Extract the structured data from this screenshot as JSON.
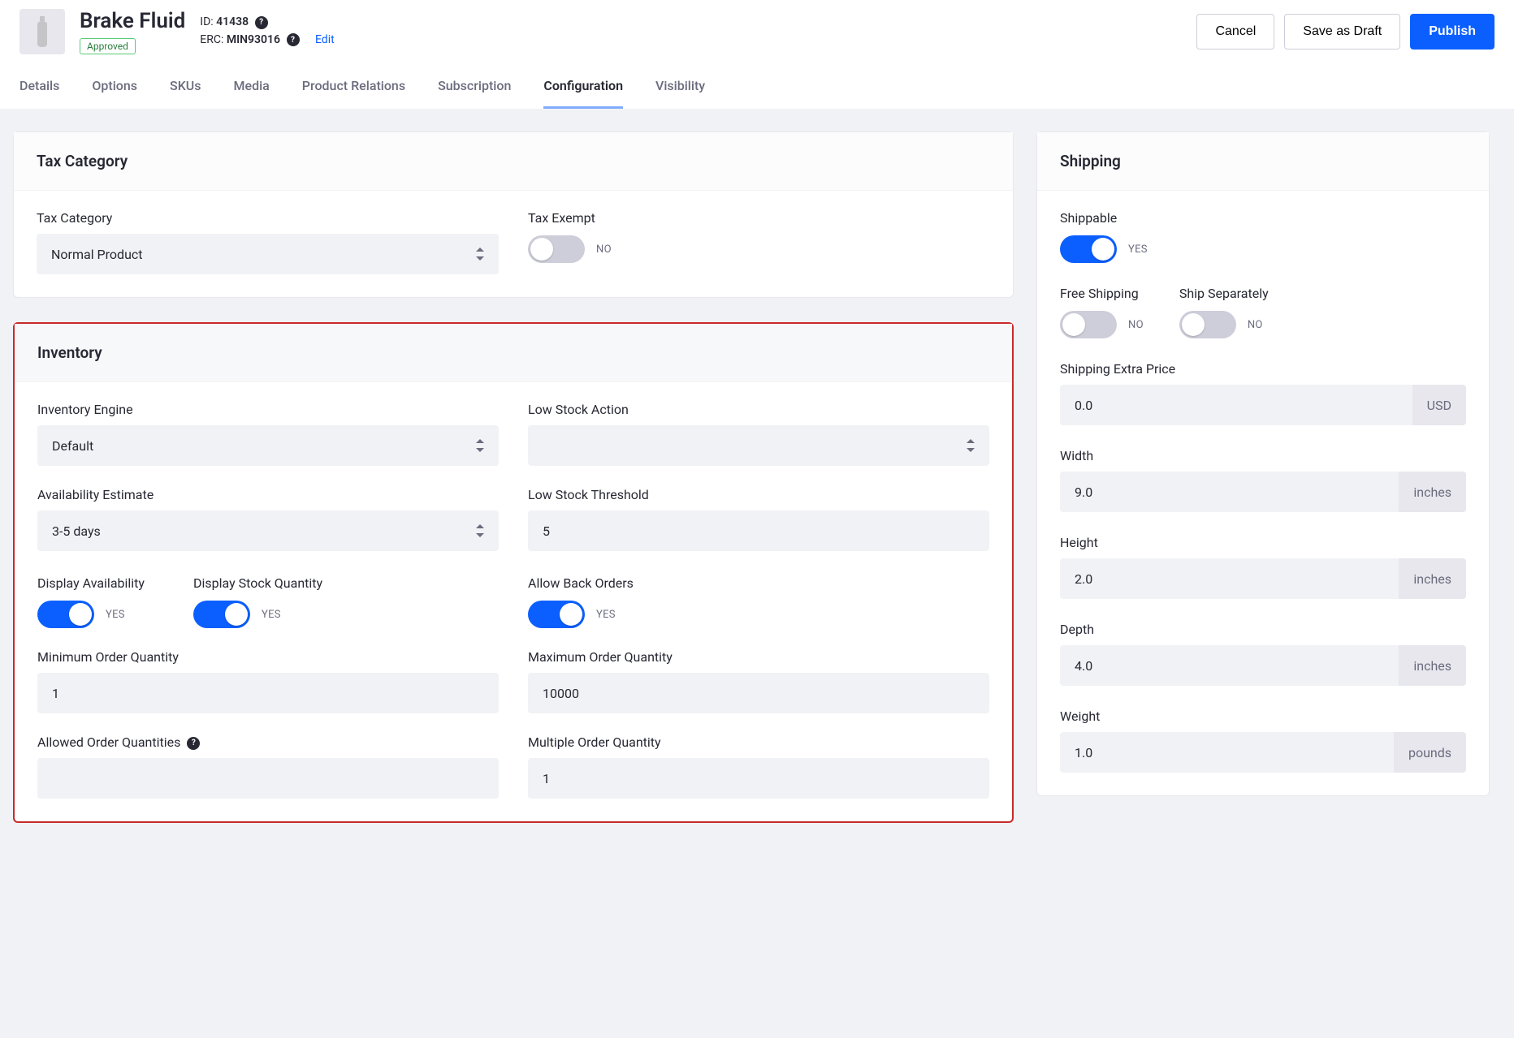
{
  "header": {
    "title": "Brake Fluid",
    "status_badge": "Approved",
    "id_label": "ID:",
    "id_value": "41438",
    "erc_label": "ERC:",
    "erc_value": "MIN93016",
    "edit": "Edit",
    "actions": {
      "cancel": "Cancel",
      "draft": "Save as Draft",
      "publish": "Publish"
    }
  },
  "tabs": [
    "Details",
    "Options",
    "SKUs",
    "Media",
    "Product Relations",
    "Subscription",
    "Configuration",
    "Visibility"
  ],
  "active_tab": "Configuration",
  "tax": {
    "panel_title": "Tax Category",
    "category_label": "Tax Category",
    "category_value": "Normal Product",
    "exempt_label": "Tax Exempt",
    "exempt_on": false,
    "exempt_text": "NO"
  },
  "inventory": {
    "panel_title": "Inventory",
    "engine_label": "Inventory Engine",
    "engine_value": "Default",
    "low_action_label": "Low Stock Action",
    "low_action_value": "",
    "avail_label": "Availability Estimate",
    "avail_value": "3-5 days",
    "threshold_label": "Low Stock Threshold",
    "threshold_value": "5",
    "disp_avail_label": "Display Availability",
    "disp_avail_text": "YES",
    "disp_stock_label": "Display Stock Quantity",
    "disp_stock_text": "YES",
    "back_label": "Allow Back Orders",
    "back_text": "YES",
    "min_label": "Minimum Order Quantity",
    "min_value": "1",
    "max_label": "Maximum Order Quantity",
    "max_value": "10000",
    "allowed_label": "Allowed Order Quantities",
    "allowed_value": "",
    "multiple_label": "Multiple Order Quantity",
    "multiple_value": "1"
  },
  "shipping": {
    "panel_title": "Shipping",
    "shippable_label": "Shippable",
    "shippable_text": "YES",
    "free_label": "Free Shipping",
    "free_text": "NO",
    "sep_label": "Ship Separately",
    "sep_text": "NO",
    "extra_label": "Shipping Extra Price",
    "extra_value": "0.0",
    "extra_unit": "USD",
    "width_label": "Width",
    "width_value": "9.0",
    "width_unit": "inches",
    "height_label": "Height",
    "height_value": "2.0",
    "height_unit": "inches",
    "depth_label": "Depth",
    "depth_value": "4.0",
    "depth_unit": "inches",
    "weight_label": "Weight",
    "weight_value": "1.0",
    "weight_unit": "pounds"
  }
}
